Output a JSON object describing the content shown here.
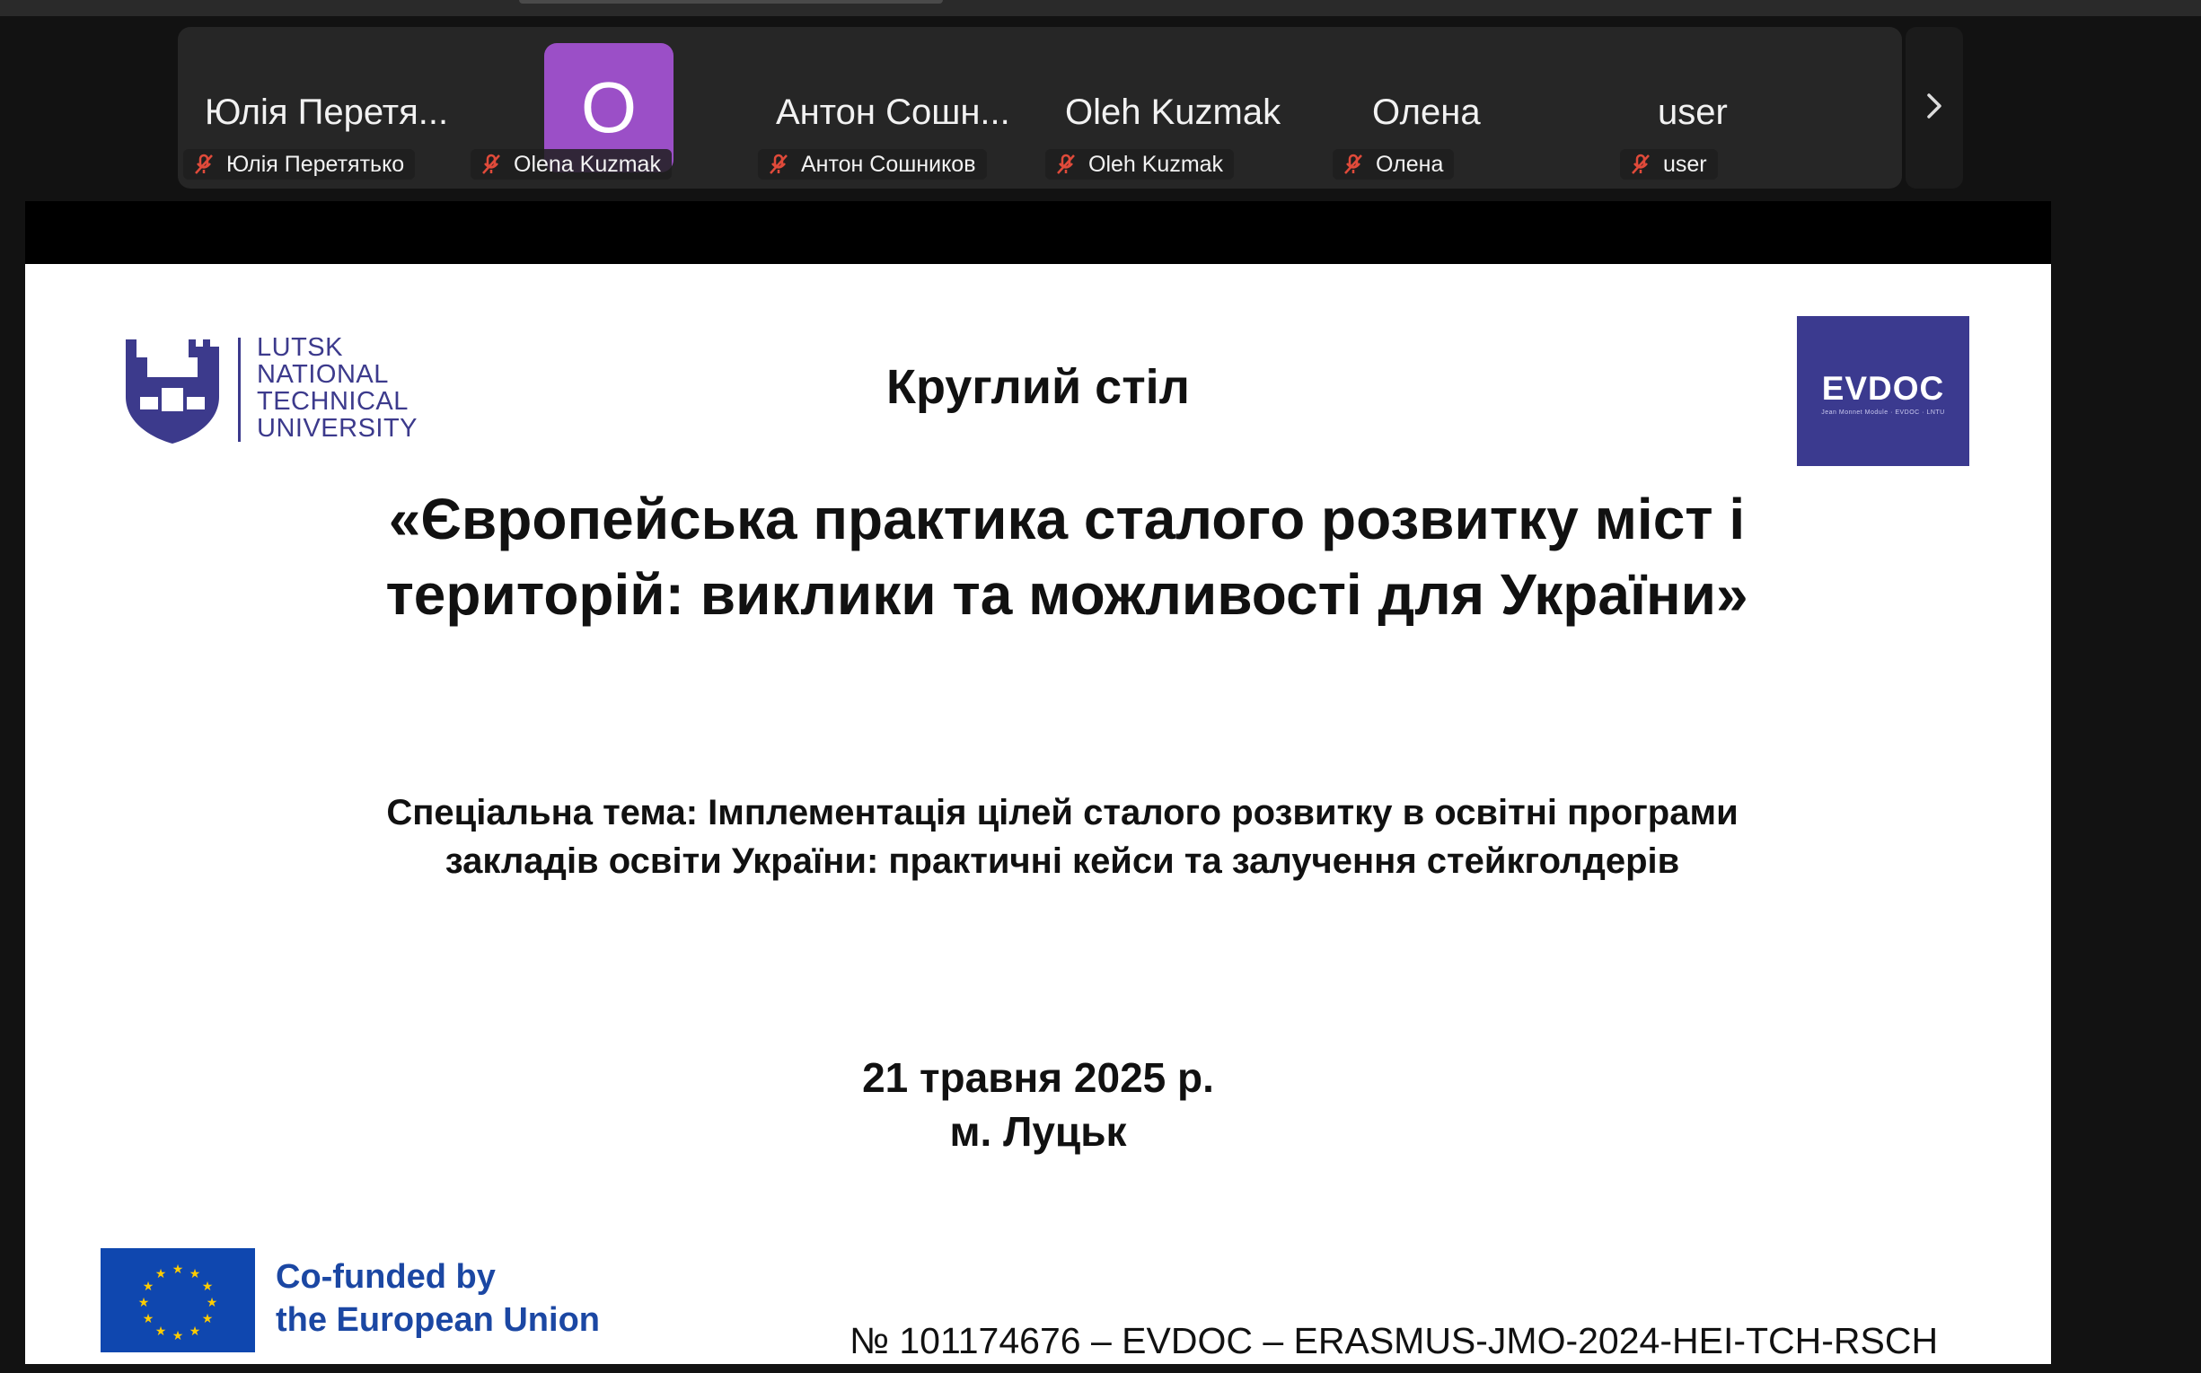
{
  "participants": [
    {
      "name": "Юлія Перетя...",
      "label": "Юлія Перетятько"
    },
    {
      "name": "",
      "initial": "O",
      "label": "Olena Kuzmak"
    },
    {
      "name": "Антон  Сошн...",
      "label": "Антон  Сошников"
    },
    {
      "name": "Oleh Kuzmak",
      "label": "Oleh Kuzmak"
    },
    {
      "name": "Олена",
      "label": "Олена"
    },
    {
      "name": "user",
      "label": "user"
    }
  ],
  "avatar_color": "#9b4fc7",
  "icons": {
    "muted": "mic-muted-icon",
    "next": "chevron-right-icon"
  },
  "slide": {
    "university_logo": [
      "LUTSK",
      "NATIONAL",
      "TECHNICAL",
      "UNIVERSITY"
    ],
    "evdoc_logo": "EVDOC",
    "evdoc_tagline": "Jean Monnet Module · EVDOC · LNTU",
    "title_small": "Круглий стіл",
    "title_main": "«Європейська практика сталого розвитку міст і територій: виклики та можливості для України»",
    "subtheme_1": "Спеціальна тема: Імплементація цілей сталого розвитку в освітні програми",
    "subtheme_2": "закладів освіти України: практичні кейси та залучення стейкголдерів",
    "date": "21 травня 2025 р.",
    "city": "м. Луцьк",
    "eu_line_1": "Co-funded by",
    "eu_line_2": "the European Union",
    "project": "№ 101174676 – EVDOC – ERASMUS-JMO-2024-HEI-TCH-RSCH"
  },
  "colors": {
    "brand_blue": "#3c3a8c",
    "eu_blue": "#0f47af",
    "eu_star": "#ffcc00"
  }
}
